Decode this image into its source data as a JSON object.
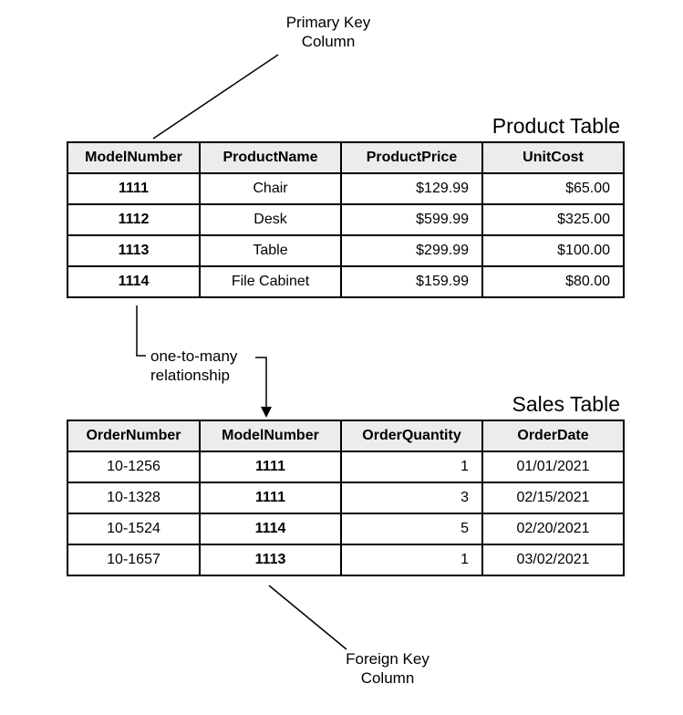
{
  "annotations": {
    "primary_key": "Primary Key\nColumn",
    "relationship": "one-to-many\nrelationship",
    "foreign_key": "Foreign Key\nColumn"
  },
  "product_table": {
    "title": "Product Table",
    "headers": {
      "col0": "ModelNumber",
      "col1": "ProductName",
      "col2": "ProductPrice",
      "col3": "UnitCost"
    },
    "rows": [
      {
        "model": "1111",
        "name": "Chair",
        "price": "$129.99",
        "cost": "$65.00"
      },
      {
        "model": "1112",
        "name": "Desk",
        "price": "$599.99",
        "cost": "$325.00"
      },
      {
        "model": "1113",
        "name": "Table",
        "price": "$299.99",
        "cost": "$100.00"
      },
      {
        "model": "1114",
        "name": "File Cabinet",
        "price": "$159.99",
        "cost": "$80.00"
      }
    ]
  },
  "sales_table": {
    "title": "Sales Table",
    "headers": {
      "col0": "OrderNumber",
      "col1": "ModelNumber",
      "col2": "OrderQuantity",
      "col3": "OrderDate"
    },
    "rows": [
      {
        "order": "10-1256",
        "model": "1111",
        "qty": "1",
        "date": "01/01/2021"
      },
      {
        "order": "10-1328",
        "model": "1111",
        "qty": "3",
        "date": "02/15/2021"
      },
      {
        "order": "10-1524",
        "model": "1114",
        "qty": "5",
        "date": "02/20/2021"
      },
      {
        "order": "10-1657",
        "model": "1113",
        "qty": "1",
        "date": "03/02/2021"
      }
    ]
  }
}
